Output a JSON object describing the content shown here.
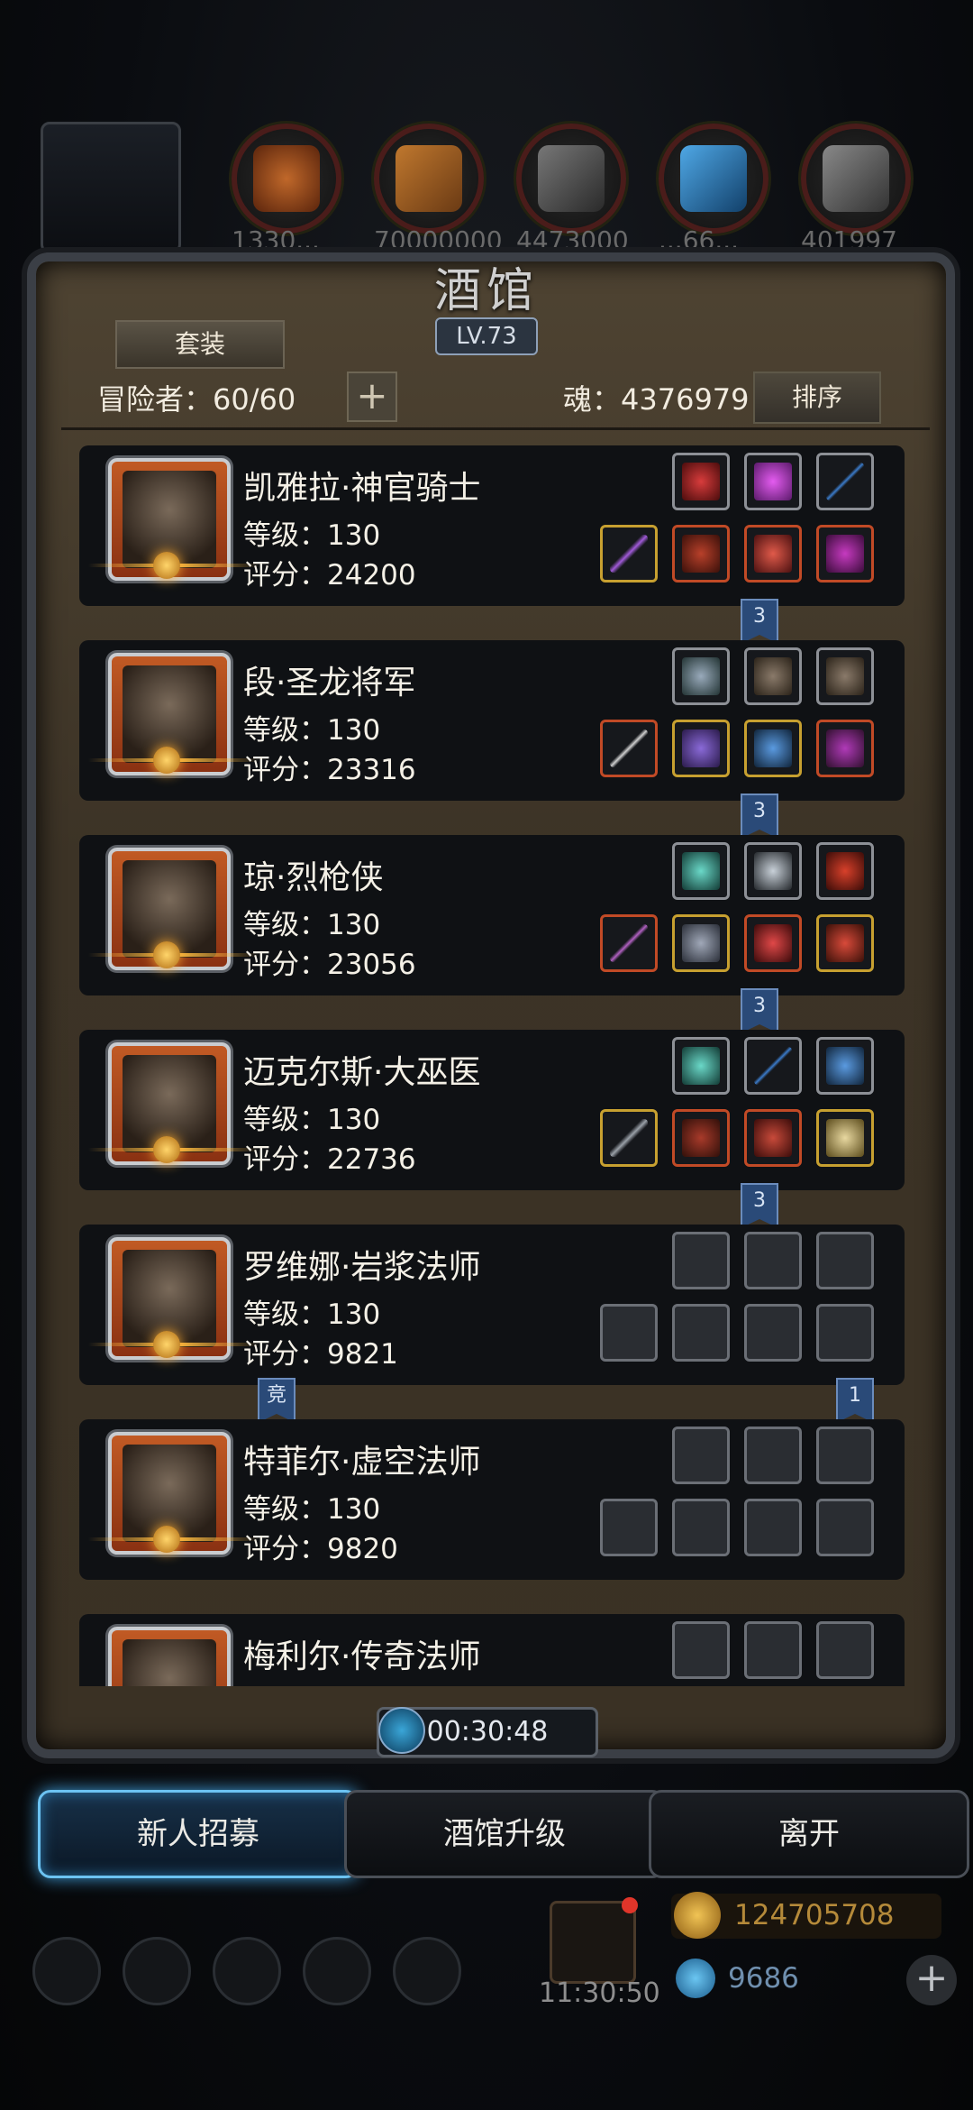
{
  "top_resources": [
    "1330...",
    "70000000",
    "4473000",
    "...66...",
    "401997"
  ],
  "title": "酒馆",
  "level": "LV.73",
  "set_button": "套装",
  "adventurers_label": "冒险者：60/60",
  "plus_symbol": "+",
  "soul_label": "魂：4376979",
  "sort_button": "排序",
  "heroes": [
    {
      "name": "凯雅拉·神官骑士",
      "level": "等级：130",
      "score": "评分：24200"
    },
    {
      "name": "段·圣龙将军",
      "level": "等级：130",
      "score": "评分：23316"
    },
    {
      "name": "琼·烈枪侠",
      "level": "等级：130",
      "score": "评分：23056"
    },
    {
      "name": "迈克尔斯·大巫医",
      "level": "等级：130",
      "score": "评分：22736"
    },
    {
      "name": "罗维娜·岩浆法师",
      "level": "等级：130",
      "score": "评分：9821"
    },
    {
      "name": "特菲尔·虚空法师",
      "level": "等级：130",
      "score": "评分：9820"
    },
    {
      "name": "梅利尔·传奇法师",
      "level": "",
      "score": ""
    }
  ],
  "connectors": [
    "3",
    "3",
    "3",
    "3",
    "竞",
    "1"
  ],
  "timer": "00:30:48",
  "buttons": {
    "recruit": "新人招募",
    "upgrade": "酒馆升级",
    "leave": "离开"
  },
  "clock": "11:30:50",
  "gold": "124705708",
  "gems": "9686",
  "add_symbol": "+"
}
